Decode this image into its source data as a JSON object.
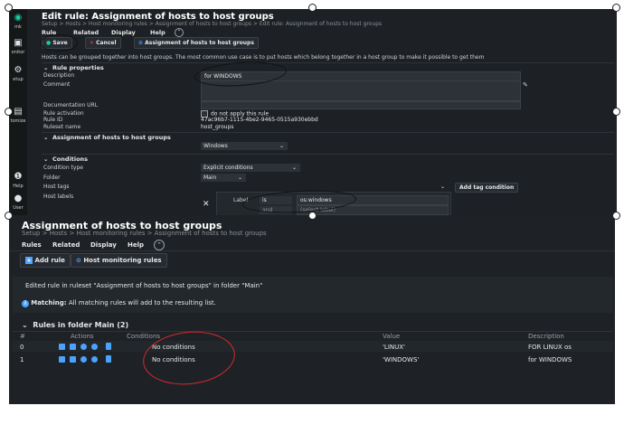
{
  "sidebar": {
    "logo": "mk",
    "items": [
      {
        "label": "onitor",
        "icon": "monitor-icon"
      },
      {
        "label": "etup",
        "icon": "gear-icon"
      },
      {
        "label": "tomize",
        "icon": "customize-icon"
      },
      {
        "label": "Help",
        "icon": "help-icon"
      },
      {
        "label": "User",
        "icon": "user-icon"
      }
    ]
  },
  "edit": {
    "title": "Edit rule: Assignment of hosts to host groups",
    "breadcrumb": "Setup > Hosts > Host monitoring rules > Assignment of hosts to host groups > Edit rule: Assignment of hosts to host groups",
    "menu": [
      "Rule",
      "Related",
      "Display",
      "Help"
    ],
    "buttons": {
      "save": "Save",
      "cancel": "Cancel",
      "assignment": "Assignment of hosts to host groups"
    },
    "intro": "Hosts can be grouped together into host groups. The most common use case is to put hosts which belong together in a host group to make it possible to get them",
    "rule_properties": {
      "section": "Rule properties",
      "description_label": "Description",
      "description_value": "for WINDOWS",
      "comment_label": "Comment",
      "documentation_label": "Documentation URL",
      "activation_label": "Rule activation",
      "activation_text": "do not apply this rule",
      "rule_id_label": "Rule ID",
      "rule_id_value": "47ac96b7-1115-4be2-9465-0515a930ebbd",
      "ruleset_label": "Ruleset name",
      "ruleset_value": "host_groups"
    },
    "assignment_section": "Assignment of hosts to host groups",
    "assignment_value": "Windows",
    "conditions": {
      "section": "Conditions",
      "condition_type_label": "Condition type",
      "condition_type_value": "Explicit conditions",
      "folder_label": "Folder",
      "folder_value": "Main",
      "host_tags_label": "Host tags",
      "add_tag_button": "Add tag condition",
      "host_labels_label": "Host labels",
      "label_text": "Label",
      "operator": "is",
      "label_value": "os:windows",
      "operator2": "and",
      "label2_placeholder": "(select label)"
    }
  },
  "overview": {
    "title": "Assignment of hosts to host groups",
    "breadcrumb": "Setup > Hosts > Host monitoring rules > Assignment of hosts to host groups",
    "menu": [
      "Rules",
      "Related",
      "Display",
      "Help"
    ],
    "buttons": {
      "add_rule": "Add rule",
      "host_monitoring": "Host monitoring rules"
    },
    "message": "Edited rule in ruleset \"Assignment of hosts to host groups\" in folder \"Main\"",
    "matching_label": "Matching:",
    "matching_text": "All matching rules will add to the resulting list.",
    "folder_heading": "Rules in folder Main (2)",
    "columns": [
      "#",
      "Actions",
      "Conditions",
      "Value",
      "Description"
    ],
    "rows": [
      {
        "index": "0",
        "conditions": "No conditions",
        "value": "'LINUX'",
        "description": "FOR LINUX os"
      },
      {
        "index": "1",
        "conditions": "No conditions",
        "value": "'WINDOWS'",
        "description": "for WINDOWS"
      }
    ]
  },
  "colors": {
    "accent": "#15d1a0",
    "background": "#1d2126",
    "annotation": "#d32b2b"
  }
}
